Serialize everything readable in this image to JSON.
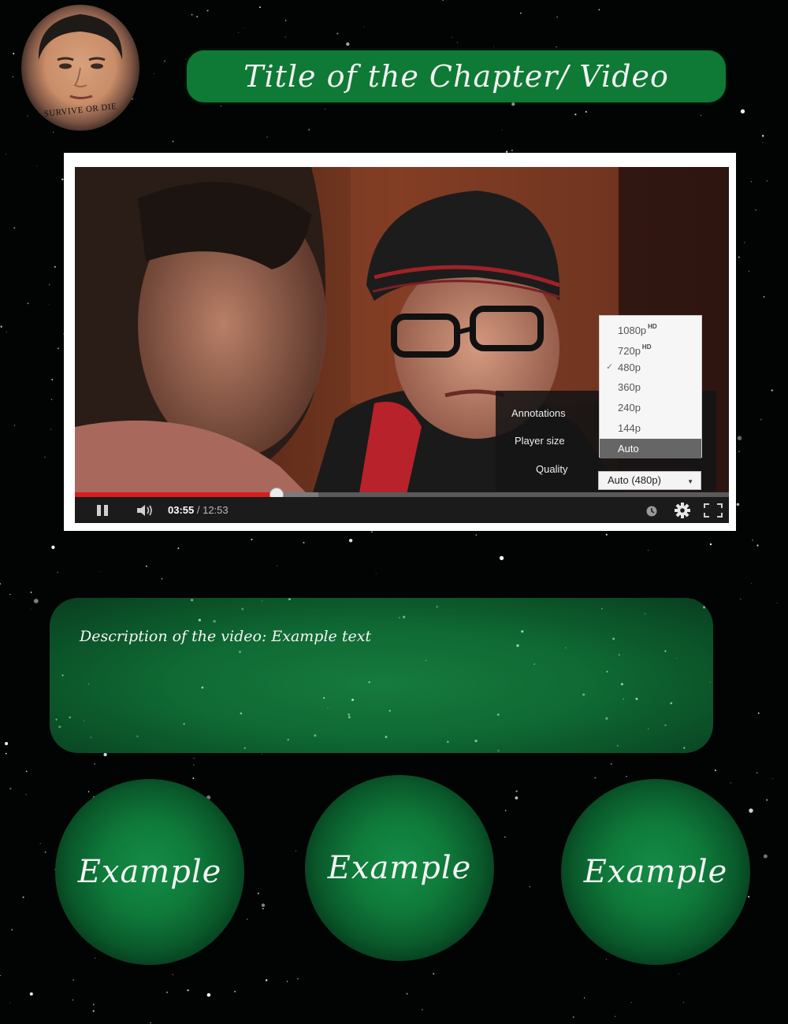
{
  "header": {
    "title": "Title of the Chapter/ Video",
    "avatar_caption": "SURVIVE OR DIE"
  },
  "video": {
    "settings": {
      "annotations_label": "Annotations",
      "player_size_label": "Player size",
      "quality_label": "Quality",
      "quality_value": "Auto (480p)"
    },
    "quality_options": [
      {
        "label": "1080p",
        "badge": "HD",
        "checked": false,
        "selected": false
      },
      {
        "label": "720p",
        "badge": "HD",
        "checked": false,
        "selected": false
      },
      {
        "label": "480p",
        "badge": "",
        "checked": true,
        "selected": false
      },
      {
        "label": "360p",
        "badge": "",
        "checked": false,
        "selected": false
      },
      {
        "label": "240p",
        "badge": "",
        "checked": false,
        "selected": false
      },
      {
        "label": "144p",
        "badge": "",
        "checked": false,
        "selected": false
      },
      {
        "label": "Auto",
        "badge": "",
        "checked": false,
        "selected": true
      }
    ],
    "current_time": "03:55",
    "time_separator": " / ",
    "duration": "12:53",
    "played_fraction": 0.308,
    "loaded_fraction": 0.372,
    "colors": {
      "progress": "#d71e1e",
      "loaded": "#7b7b7b"
    }
  },
  "description": {
    "text": "Description of the video: Example text"
  },
  "examples": [
    {
      "label": "Example"
    },
    {
      "label": "Example"
    },
    {
      "label": "Example"
    }
  ],
  "icons": {
    "pause": "pause-icon",
    "volume": "volume-icon",
    "watch_later": "clock-icon",
    "settings": "gear-icon",
    "fullscreen": "fullscreen-icon"
  },
  "colors": {
    "background": "#020403",
    "banner_green": "#0f7a35",
    "orb_green": "#148c46"
  }
}
